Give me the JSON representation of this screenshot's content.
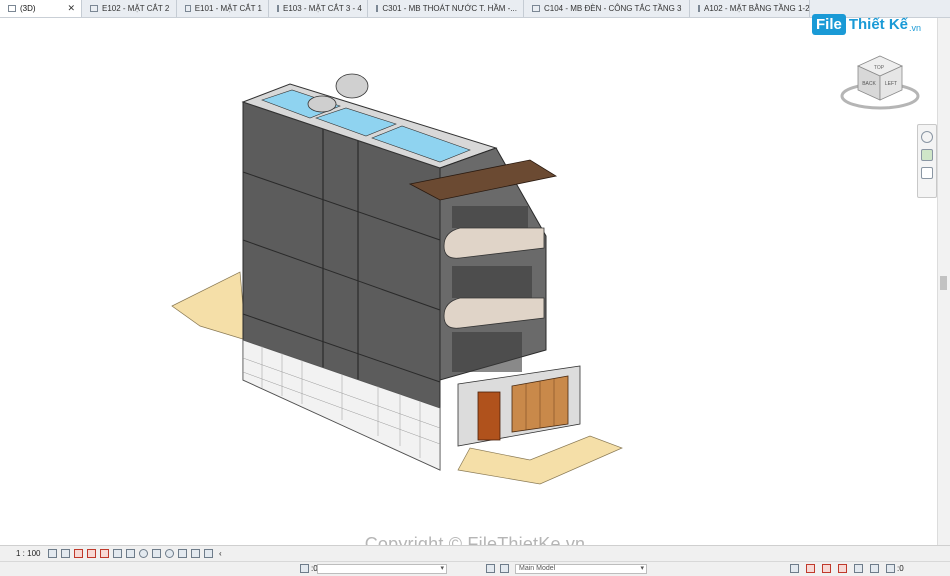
{
  "tabs": [
    {
      "label": "(3D)",
      "active": true,
      "close": "✕"
    },
    {
      "label": "E102 - MẶT CẮT 2"
    },
    {
      "label": "E101 - MẶT CẮT 1"
    },
    {
      "label": "E103 - MẶT CẮT 3 - 4"
    },
    {
      "label": "C301 - MB THOÁT NƯỚC T. HẦM  -..."
    },
    {
      "label": "C104 - MB ĐÈN - CÔNG TẮC TẦNG 3"
    },
    {
      "label": "A102 - MẶT BẰNG TẦNG 1-2"
    }
  ],
  "logo": {
    "file": "File",
    "rest": "Thiết Kế",
    "suffix": ".vn"
  },
  "viewcube": {
    "face_top": "TOP",
    "face_back": "BACK",
    "face_left": "LEFT"
  },
  "watermark": "Copyright © FileThietKe.vn",
  "viewbar": {
    "scale": "1 : 100",
    "more": "‹"
  },
  "statusbar": {
    "selection_count": ":0",
    "workset_placeholder": "",
    "design_option": "Main Model",
    "filter_count": ":0"
  },
  "colors": {
    "accent": "#1a9ad6",
    "wall_dark": "#5a5a5a",
    "glass": "#8fd3f0",
    "ground": "#f5dfa8",
    "door": "#b0521c"
  }
}
